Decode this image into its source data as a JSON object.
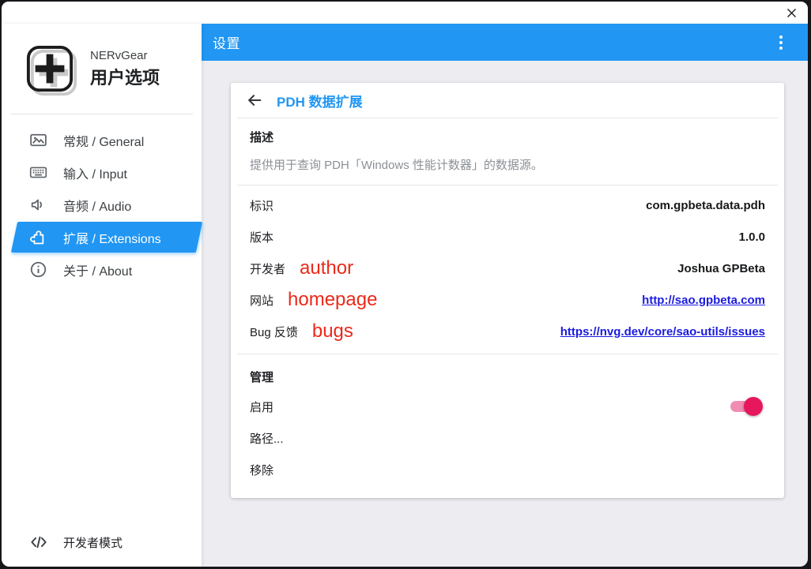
{
  "window": {
    "close": "✕"
  },
  "sidebar": {
    "app_name": "NERvGear",
    "app_subtitle": "用户选项",
    "items": [
      {
        "label": "常规 / General",
        "icon": "image-icon",
        "selected": false
      },
      {
        "label": "输入 / Input",
        "icon": "keyboard-icon",
        "selected": false
      },
      {
        "label": "音频 / Audio",
        "icon": "speaker-icon",
        "selected": false
      },
      {
        "label": "扩展 / Extensions",
        "icon": "puzzle-icon",
        "selected": true
      },
      {
        "label": "关于 / About",
        "icon": "info-icon",
        "selected": false
      }
    ],
    "developer_mode_label": "开发者模式"
  },
  "appbar": {
    "title": "设置",
    "menu_icon": "kebab-menu-icon"
  },
  "extension": {
    "title": "PDH 数据扩展",
    "back_icon": "back-arrow-icon",
    "description_heading": "描述",
    "description": "提供用于查询 PDH「Windows 性能计数器」的数据源。",
    "fields": [
      {
        "label": "标识",
        "value": "com.gpbeta.data.pdh",
        "type": "text"
      },
      {
        "label": "版本",
        "value": "1.0.0",
        "type": "text"
      },
      {
        "label": "开发者",
        "annotation": "author",
        "value": "Joshua GPBeta",
        "type": "text"
      },
      {
        "label": "网站",
        "annotation": "homepage",
        "value": "http://sao.gpbeta.com",
        "type": "link"
      },
      {
        "label": "Bug 反馈",
        "annotation": "bugs",
        "value": "https://nvg.dev/core/sao-utils/issues",
        "type": "link"
      }
    ],
    "manage": {
      "heading": "管理",
      "enable_label": "启用",
      "enable_state": "on",
      "path_label": "路径...",
      "remove_label": "移除"
    }
  },
  "colors": {
    "accent_blue": "#2196f3",
    "link_blue": "#1b1be0",
    "annotation_red": "#ea2a1a",
    "toggle_knob_pink": "#e6175c",
    "toggle_track_pink": "#f08cb3",
    "content_background": "#ededf1"
  }
}
